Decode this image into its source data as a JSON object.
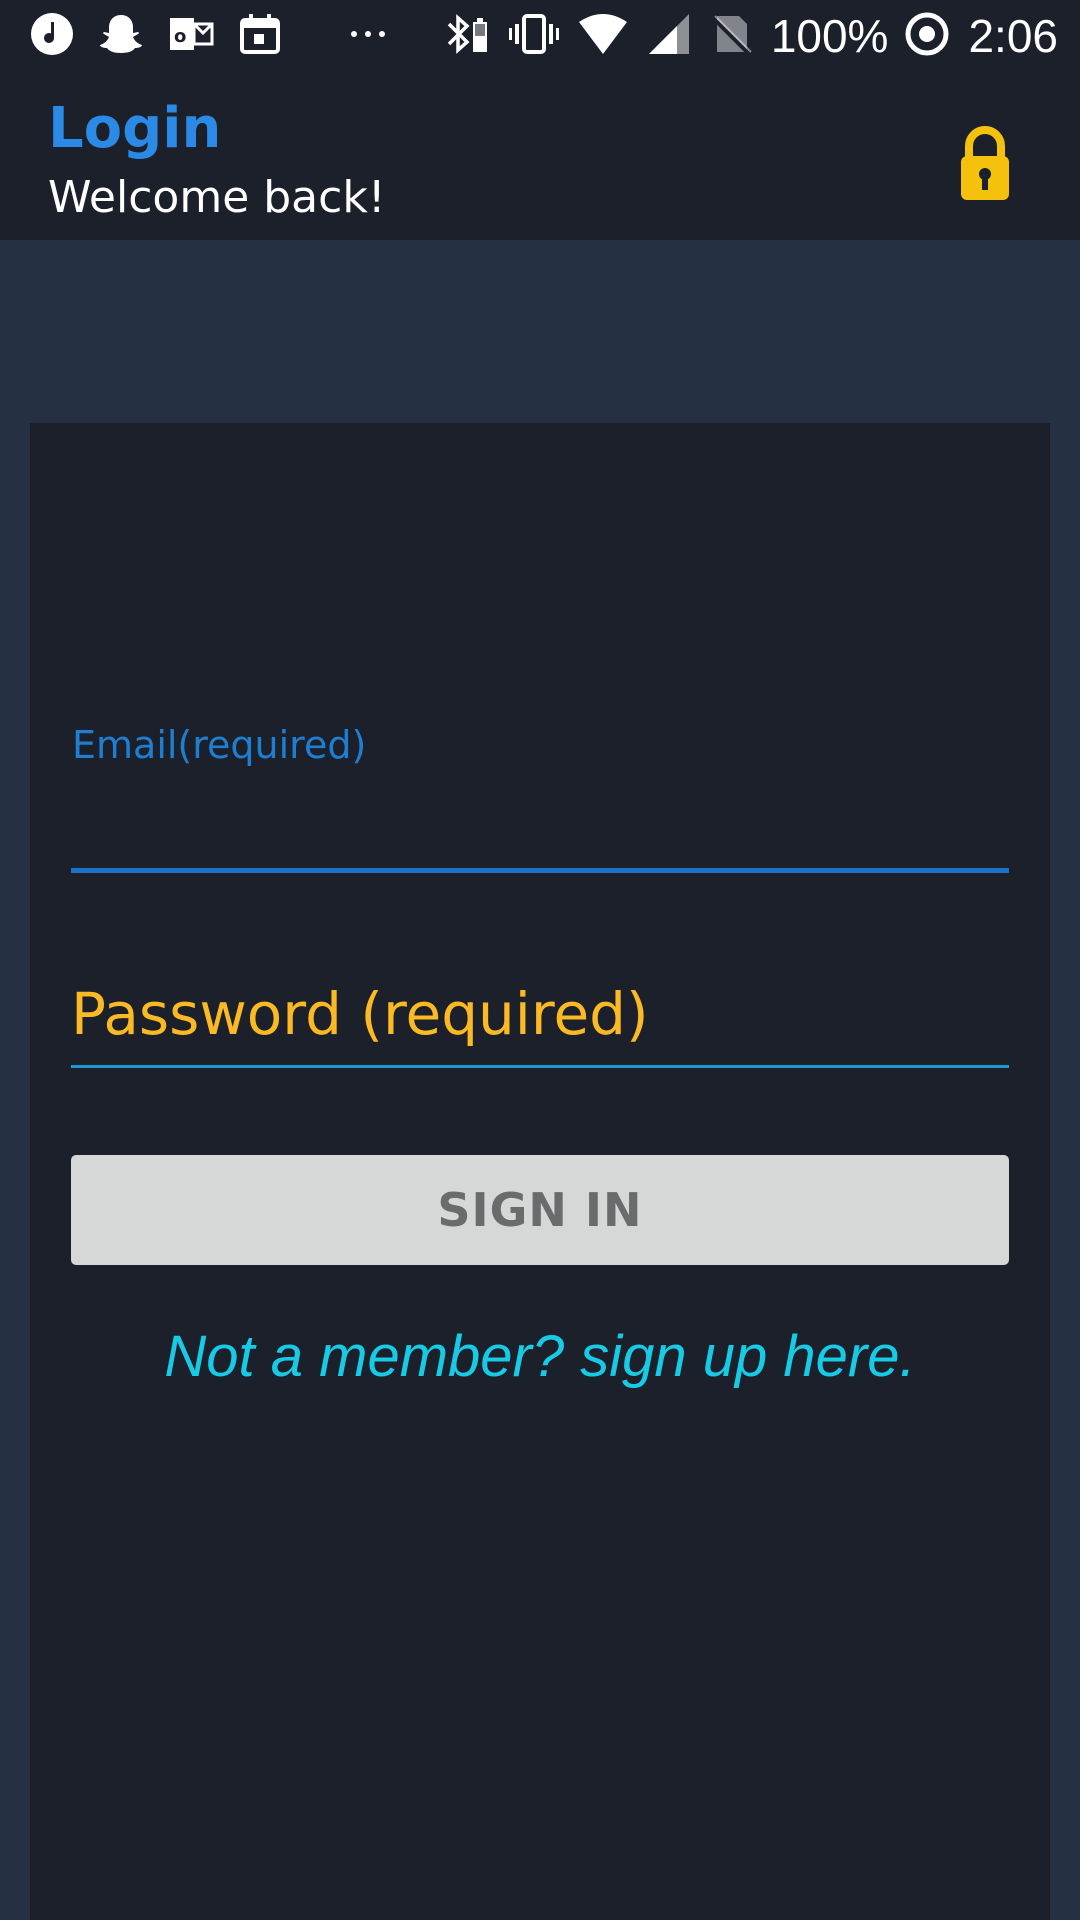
{
  "status_bar": {
    "notification_icons": [
      "music-note-icon",
      "snapchat-icon",
      "outlook-icon",
      "calendar-icon",
      "more-dots-icon"
    ],
    "system_icons": [
      "bluetooth-icon",
      "vibrate-icon",
      "wifi-icon",
      "cell-signal-icon",
      "no-sim-icon"
    ],
    "battery_percent": "100%",
    "time": "2:06"
  },
  "header": {
    "title": "Login",
    "subtitle": "Welcome back!",
    "lock_icon": "lock-icon",
    "colors": {
      "title": "#2b8ae6",
      "lock": "#f4c20d"
    }
  },
  "form": {
    "email_label": "Email(required)",
    "email_value": "",
    "password_placeholder": "Password (required)",
    "password_value": "",
    "signin_label": "SIGN IN",
    "signup_link": "Not a member? sign up here."
  },
  "colors": {
    "background": "#253142",
    "card": "#1b202a",
    "email_accent": "#1a73c9",
    "password_text": "#fbb924",
    "signin_bg": "#d6d7d7",
    "link": "#17cbe6"
  }
}
